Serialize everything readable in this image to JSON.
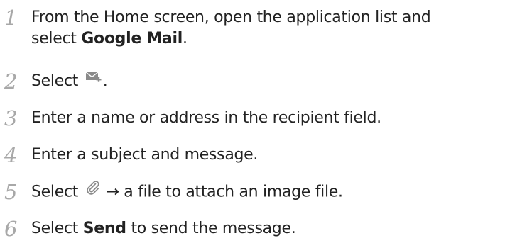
{
  "steps": [
    {
      "number": "1",
      "line1": "From the Home screen, open the application list and",
      "line2_prefix": "select ",
      "line2_bold": "Google Mail",
      "line2_suffix": "."
    },
    {
      "number": "2",
      "prefix": "Select ",
      "icon": "compose-mail-icon",
      "suffix": "."
    },
    {
      "number": "3",
      "text": "Enter a name or address in the recipient field."
    },
    {
      "number": "4",
      "text": "Enter a subject and message."
    },
    {
      "number": "5",
      "prefix": "Select ",
      "icon": "paperclip-icon",
      "suffix": " → a file to attach an image file."
    },
    {
      "number": "6",
      "prefix": "Select ",
      "bold": "Send",
      "suffix": " to send the message."
    }
  ],
  "colors": {
    "number": "#a8a8a8",
    "text": "#222222",
    "icon": "#8a8a8a"
  }
}
